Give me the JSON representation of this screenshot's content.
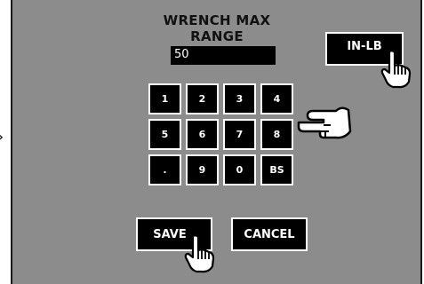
{
  "screen": {
    "title": "WRENCH MAX RANGE",
    "value": "50",
    "unit_button_label": "IN-LB"
  },
  "keypad": {
    "keys": [
      "1",
      "2",
      "3",
      "4",
      "5",
      "6",
      "7",
      "8",
      ".",
      "9",
      "0",
      "BS"
    ]
  },
  "actions": {
    "save_label": "SAVE",
    "cancel_label": "CANCEL"
  }
}
